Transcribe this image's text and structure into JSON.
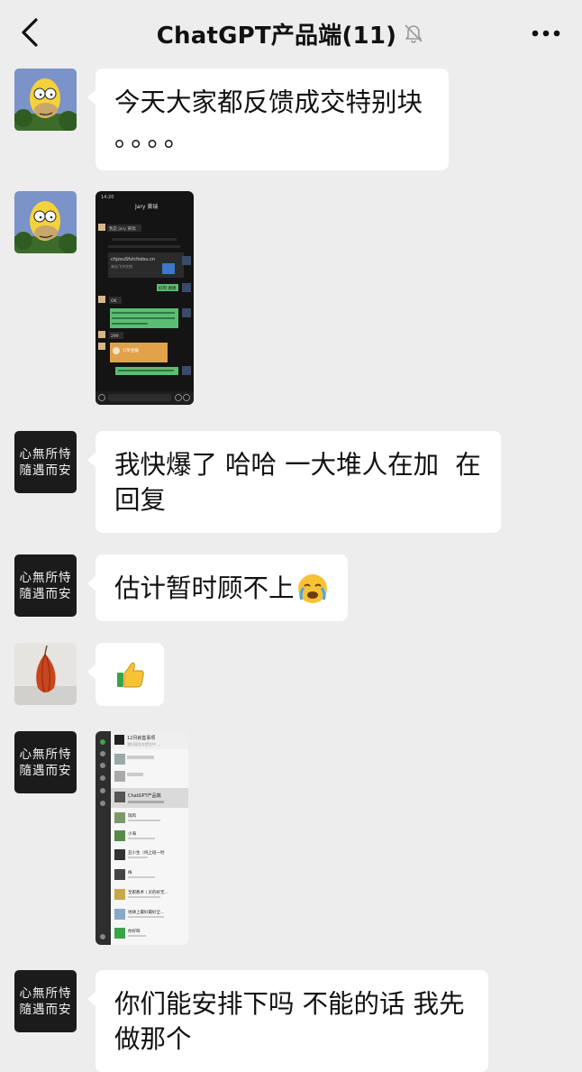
{
  "header": {
    "title": "ChatGPT产品端(11)",
    "back_icon": "chevron-left-icon",
    "mute_icon": "bell-off-icon",
    "more_icon": "more-dots-icon"
  },
  "avatars": {
    "calligraphy_line1": "心無所恃",
    "calligraphy_line2": "隨遇而安"
  },
  "messages": [
    {
      "type": "text",
      "line1": "今天大家都反馈成交特别块",
      "line2": "。。。。"
    },
    {
      "type": "image",
      "desc": "chat-screenshot"
    },
    {
      "type": "text",
      "line1": "我快爆了 哈哈 一大堆人在加  在",
      "line2": "回复"
    },
    {
      "type": "text",
      "line1": "估计暂时顾不上",
      "emoji": "😭"
    },
    {
      "type": "emoji",
      "emoji": "👍"
    },
    {
      "type": "image",
      "desc": "wechat-list-screenshot"
    },
    {
      "type": "text",
      "line1": "你们能安排下吗 不能的话 我先",
      "line2": "做那个"
    }
  ],
  "shot1": {
    "status_time": "14:20",
    "title": "Jary 黄瑞",
    "invite": "我是 Jary 黄瑞",
    "link": "chjzxuSfvIcfsdsu.cn",
    "link_sub": "来自飞书文档",
    "reply1": "好的 谢谢",
    "ok": "OK",
    "green_long": "我不管那可以直接安排，20分钟加入群。付要今天下午一点。",
    "num": "299",
    "order": "订单金额",
    "last": "收到，一分钟后立即给您安排"
  },
  "shot2": {
    "top_item": "12月就售事项",
    "top_sub": "我们现在在提交中 ...",
    "selected": "ChatGPT产品端",
    "item1": "瑞风",
    "item2": "小海",
    "item3": "丑小生（纯上班一时",
    "item4": "梅",
    "item5": "至职教术丨买的好无...",
    "item6": "地球上最好最好全...",
    "item7": "你好呀"
  }
}
